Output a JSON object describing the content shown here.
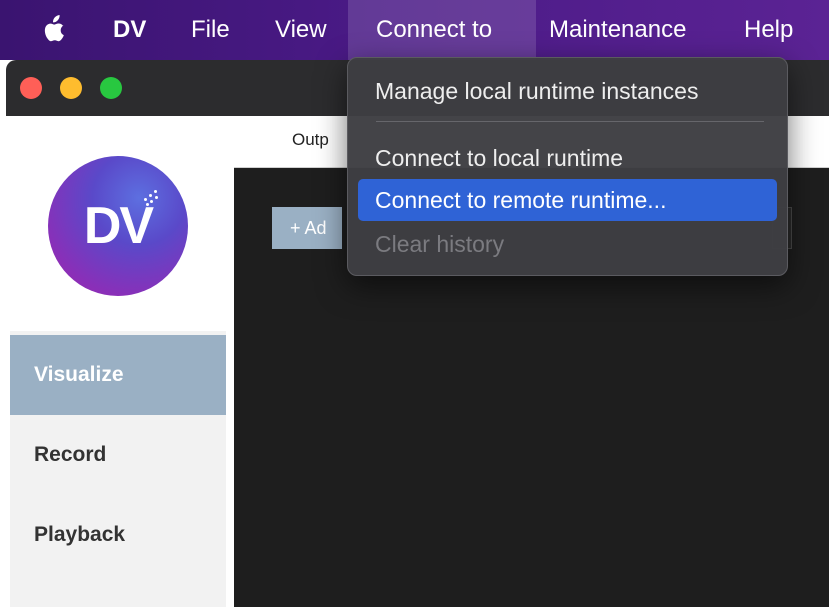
{
  "menubar": {
    "apple_icon": "apple-icon",
    "app_name": "DV",
    "items": [
      "File",
      "View",
      "Connect to",
      "Maintenance",
      "Help"
    ],
    "background": "#4a1a86"
  },
  "window": {
    "traffic_lights": {
      "close": "#ff5f57",
      "minimize": "#febc2e",
      "zoom": "#28c840"
    }
  },
  "sidebar": {
    "logo_text": "DV",
    "items": [
      {
        "label": "Visualize",
        "active": true
      },
      {
        "label": "Record",
        "active": false
      },
      {
        "label": "Playback",
        "active": false
      }
    ],
    "active_color": "#9ab0c4"
  },
  "main": {
    "tab_label": "Outp",
    "add_button_icon": "+",
    "add_button_label": "Ad"
  },
  "dropdown": {
    "items": [
      {
        "label": "Manage local runtime instances",
        "state": "normal"
      },
      {
        "label": "Connect to local runtime",
        "state": "normal"
      },
      {
        "label": "Connect to remote runtime...",
        "state": "highlighted"
      },
      {
        "label": "Clear history",
        "state": "disabled"
      }
    ],
    "highlight_color": "#2f63d6"
  }
}
